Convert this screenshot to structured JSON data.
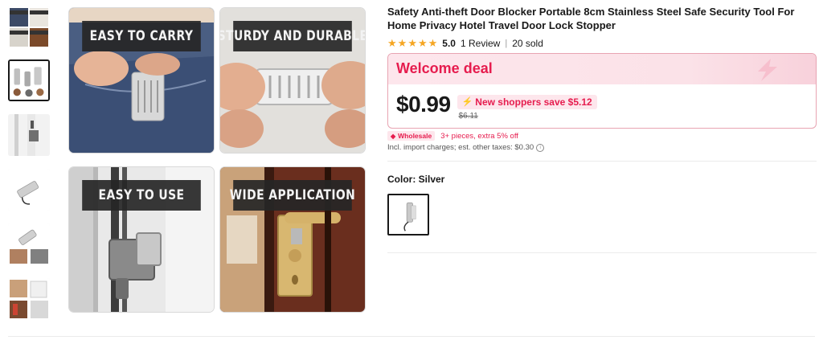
{
  "product": {
    "title": "Safety Anti-theft Door Blocker Portable 8cm Stainless Steel Safe Security Tool For Home Privacy Hotel Travel Door Lock Stopper",
    "rating": "5.0",
    "reviews": "1 Review",
    "separator": "|",
    "sold": "20 sold",
    "stars_filled": 5
  },
  "gallery": {
    "thumbnails": [
      "thumbnail-1",
      "thumbnail-2",
      "thumbnail-3",
      "thumbnail-4",
      "thumbnail-5",
      "thumbnail-6"
    ],
    "active_index": 1,
    "panels": [
      "EASY TO CARRY",
      "STURDY AND DURABLE",
      "EASY TO USE",
      "WIDE APPLICATION"
    ]
  },
  "deal": {
    "title": "Welcome deal",
    "price": "$0.99",
    "save_text": "New shoppers save $5.12",
    "old_price": "$6.11",
    "accent_color": "#e61c4e"
  },
  "wholesale": {
    "badge": "Wholesale",
    "text": "3+ pieces, extra 5% off"
  },
  "tax": {
    "text": "Incl. import charges; est. other taxes: $0.30"
  },
  "color": {
    "label": "Color: Silver"
  },
  "icons": {
    "star": "star-icon",
    "bolt": "lightning-icon",
    "tag": "tag-icon",
    "info": "info-icon"
  }
}
